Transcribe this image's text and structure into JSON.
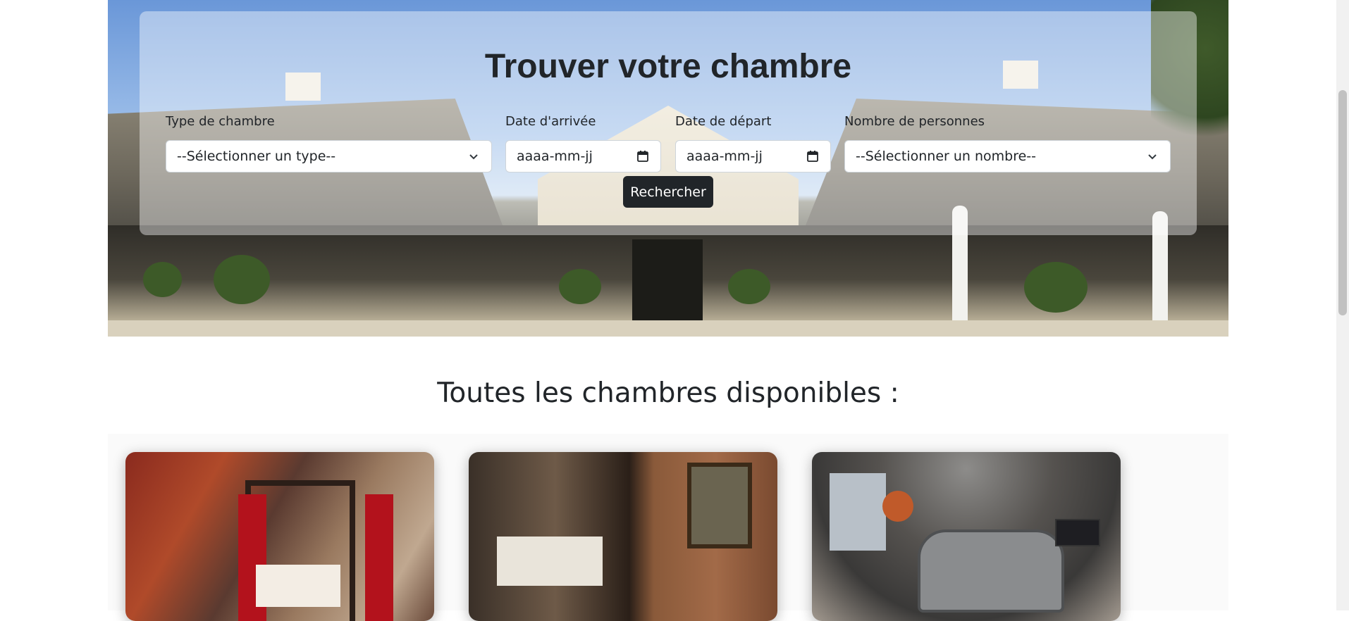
{
  "search": {
    "title": "Trouver votre chambre",
    "room_type": {
      "label": "Type de chambre",
      "value": "--Sélectionner un type--"
    },
    "arrival": {
      "label": "Date d'arrivée",
      "value": "aaaa-mm-jj"
    },
    "departure": {
      "label": "Date de départ",
      "value": "aaaa-mm-jj"
    },
    "guests": {
      "label": "Nombre de personnes",
      "value": "--Sélectionner un nombre--"
    },
    "button_label": "Rechercher"
  },
  "rooms_section": {
    "title": "Toutes les chambres disponibles :"
  },
  "colors": {
    "primary_dark": "#212529",
    "panel_overlay": "rgba(255,255,255,0.42)"
  },
  "icons": {
    "select_arrow": "chevron-down-icon",
    "date_picker": "calendar-icon"
  }
}
